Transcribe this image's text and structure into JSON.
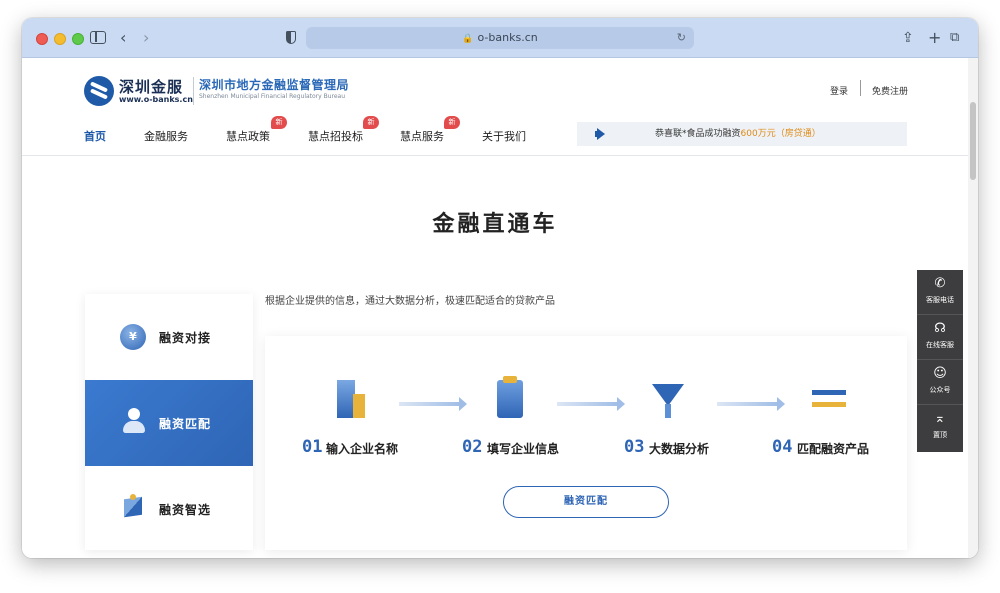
{
  "browser": {
    "url": "o-banks.cn"
  },
  "header": {
    "logo_cn": "深圳金服",
    "logo_url": "www.o-banks.cn",
    "bureau_cn": "深圳市地方金融监督管理局",
    "bureau_en": "Shenzhen Municipal Financial Regulatory Bureau",
    "login": "登录",
    "register": "免费注册"
  },
  "nav": {
    "items": [
      {
        "label": "首页",
        "new": false
      },
      {
        "label": "金融服务",
        "new": false
      },
      {
        "label": "慧点政策",
        "new": true
      },
      {
        "label": "慧点招投标",
        "new": true
      },
      {
        "label": "慧点服务",
        "new": true
      },
      {
        "label": "关于我们",
        "new": false
      }
    ],
    "new_badge": "新"
  },
  "notice": {
    "prefix": "恭喜联*食品成功融资",
    "amount": "600万元",
    "suffix": "（房贷通）"
  },
  "section": {
    "title": "金融直通车",
    "intro": "根据企业提供的信息，通过大数据分析，极速匹配适合的贷款产品"
  },
  "side_menu": [
    {
      "label": "融资对接",
      "active": false
    },
    {
      "label": "融资匹配",
      "active": true
    },
    {
      "label": "融资智选",
      "active": false
    }
  ],
  "steps": [
    {
      "num": "01",
      "label": "输入企业名称"
    },
    {
      "num": "02",
      "label": "填写企业信息"
    },
    {
      "num": "03",
      "label": "大数据分析"
    },
    {
      "num": "04",
      "label": "匹配融资产品"
    }
  ],
  "match_button": "融资匹配",
  "float_panel": [
    {
      "label": "客服电话",
      "icon": "phone-icon"
    },
    {
      "label": "在线客服",
      "icon": "headset-icon"
    },
    {
      "label": "公众号",
      "icon": "wechat-icon"
    },
    {
      "label": "置顶",
      "icon": "back-to-top-icon"
    }
  ],
  "colors": {
    "brand_blue": "#2f65b5",
    "accent_gold": "#e7b33a",
    "badge_red": "#e24c4c",
    "notice_orange": "#e08a16"
  }
}
